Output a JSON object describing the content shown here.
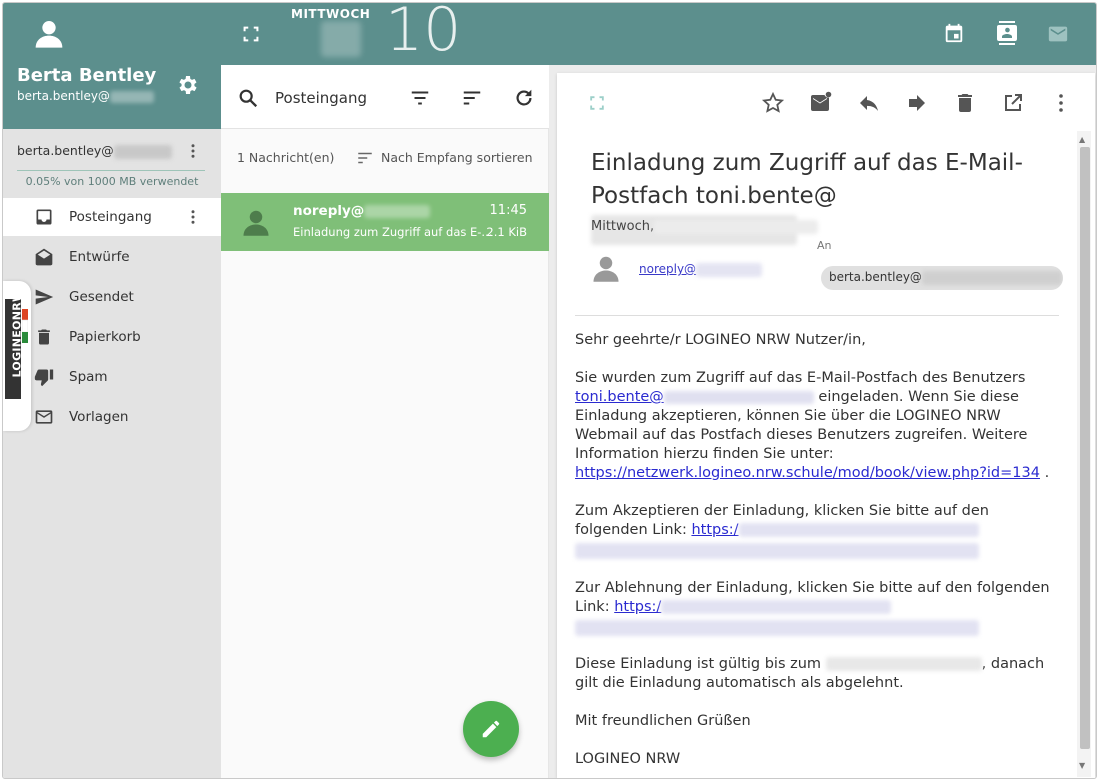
{
  "colors": {
    "teal": "#5c8f8d",
    "sidebar_bg": "#e3e3e3",
    "selected_message": "#7fbf78",
    "fab": "#4caf50",
    "link": "#2a2ad0"
  },
  "sidebar": {
    "user_name": "Berta Bentley",
    "user_email": "berta.bentley@",
    "account_email": "berta.bentley@",
    "usage": "0.05% von 1000 MB verwendet",
    "folders": [
      {
        "label": "Posteingang",
        "icon": "inbox-icon"
      },
      {
        "label": "Entwürfe",
        "icon": "drafts-icon"
      },
      {
        "label": "Gesendet",
        "icon": "send-icon"
      },
      {
        "label": "Papierkorb",
        "icon": "trash-icon"
      },
      {
        "label": "Spam",
        "icon": "thumb-down-icon"
      },
      {
        "label": "Vorlagen",
        "icon": "template-mail-icon"
      }
    ],
    "brand": {
      "part1": "LOGINEO",
      "part2": "NRW"
    }
  },
  "topbar": {
    "weekday": "MITTWOCH",
    "day": "10"
  },
  "list": {
    "search_label": "Posteingang",
    "count": "1 Nachricht(en)",
    "sort_label": "Nach Empfang sortieren",
    "messages": [
      {
        "from": "noreply@",
        "time": "11:45",
        "subject": "Einladung zum Zugriff auf das E-...",
        "size": "2.1 KiB"
      }
    ]
  },
  "reader": {
    "title": "Einladung zum Zugriff auf das E-Mail-Postfach toni.bente@",
    "date_prefix": "Mittwoch,",
    "to_label": "An",
    "sender": "noreply@",
    "recipient": "berta.bentley@",
    "body": {
      "greeting": "Sehr geehrte/r LOGINEO NRW Nutzer/in,",
      "p1_a": "Sie wurden zum Zugriff auf das E-Mail-Postfach des Benutzers",
      "p1_link": "toni.bente@",
      "p1_b": "eingeladen. Wenn Sie diese Einladung akzeptieren, können Sie über die LOGINEO NRW Webmail auf das Postfach dieses Benutzers zugreifen. Weitere Information hierzu finden Sie unter:",
      "p1_url": "https://netzwerk.logineo.nrw.schule/mod/book/view.php?id=134",
      "p1_end": " .",
      "p2": "Zum Akzeptieren der Einladung, klicken Sie bitte auf den folgenden Link:",
      "p2_link": "https:/",
      "p3": "Zur Ablehnung der Einladung, klicken Sie bitte auf den folgenden Link:",
      "p3_link": "https:/",
      "p4_a": "Diese Einladung ist gültig bis zum",
      "p4_b": ", danach gilt die Einladung automatisch als abgelehnt.",
      "closing": "Mit freundlichen Grüßen",
      "signature": "LOGINEO NRW"
    }
  }
}
